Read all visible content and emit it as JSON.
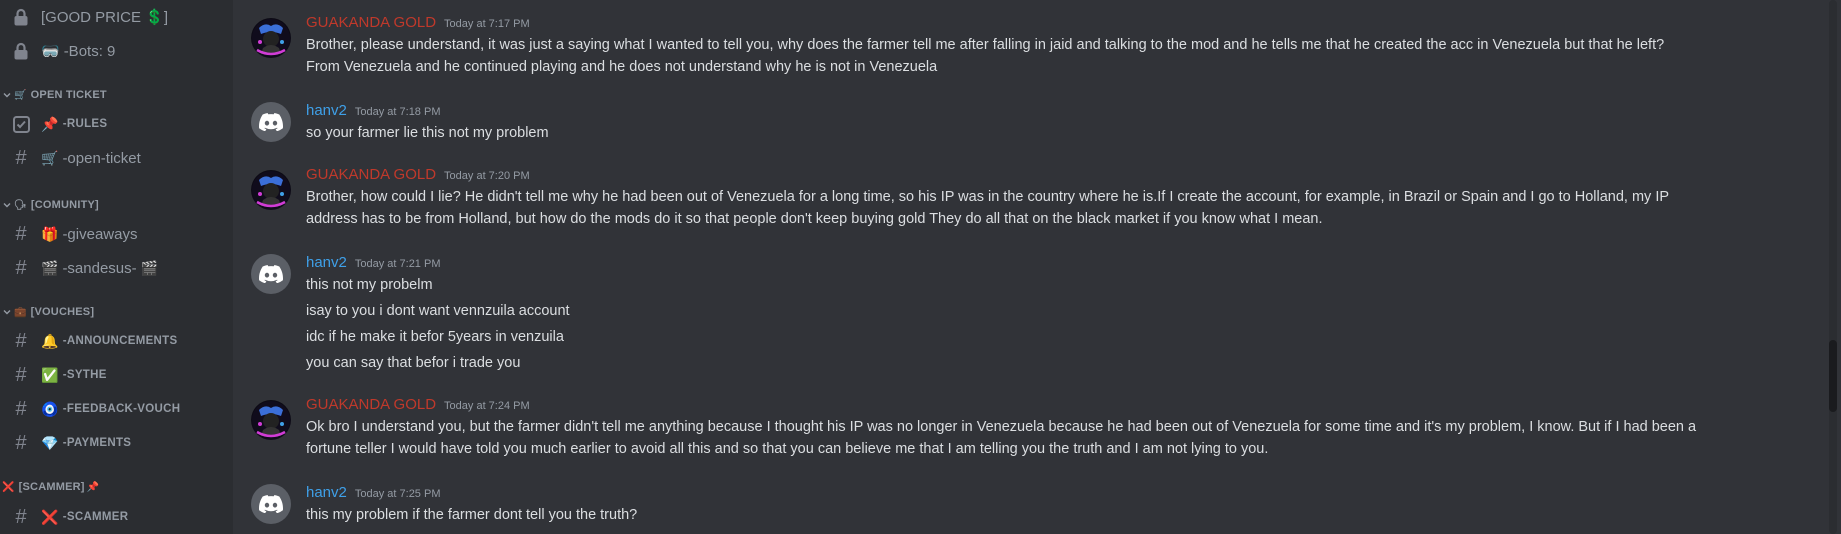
{
  "sidebar": {
    "channels": [
      {
        "name": "[GOOD PRICE 💲]",
        "icon": "lock-icon"
      },
      {
        "name": "-Bots: 9",
        "emoji": "🥽",
        "icon": "lock-icon"
      }
    ],
    "categories": [
      {
        "name": "OPEN TICKET",
        "emoji": "🛒"
      },
      {
        "name": "[COMUNITY]",
        "emoji": "🗣"
      },
      {
        "name": "[VOUCHES]",
        "emoji": "💼"
      },
      {
        "name": "[SCAMMER]",
        "emoji": "❌",
        "suffix": "📌"
      }
    ],
    "open_ticket": [
      {
        "name": "-RULES",
        "emoji": "📌",
        "icon": "rules-checkbox-icon"
      },
      {
        "name": "-open-ticket",
        "emoji": "🛒",
        "icon": "hash-icon"
      }
    ],
    "community": [
      {
        "name": "-giveaways",
        "emoji": "🎁",
        "icon": "hash-icon"
      },
      {
        "name": "-sandesus-",
        "emoji": "🎬",
        "suffix": "🎬",
        "icon": "hash-icon"
      }
    ],
    "vouches": [
      {
        "name": "-ANNOUNCEMENTS",
        "emoji": "🔔",
        "icon": "hash-icon"
      },
      {
        "name": "-SYTHE",
        "emoji": "✅",
        "icon": "hash-icon"
      },
      {
        "name": "-FEEDBACK-VOUCH",
        "emoji": "🧿",
        "icon": "hash-icon"
      },
      {
        "name": "-PAYMENTS",
        "emoji": "💎",
        "icon": "hash-icon"
      }
    ],
    "scammer": [
      {
        "name": "-SCAMMER",
        "emoji": "❌",
        "icon": "hash-icon"
      }
    ]
  },
  "colors": {
    "chat_bg": "#313338",
    "sidebar_bg": "#2b2d31",
    "gold_name": "#c0392b",
    "hanv_name": "#3fa0e8",
    "text": "#dbdee1",
    "muted": "#949ba4"
  },
  "messages": [
    {
      "author": "GUAKANDA GOLD",
      "time": "Today at 7:17 PM",
      "lines": [
        "Brother, please understand, it was just a saying what I wanted to tell you, why does the farmer tell me after falling in jaid and talking to the mod and he tells me that he created the acc in Venezuela but that he left?",
        "From Venezuela and he continued playing and he does not understand why he is not in Venezuela"
      ]
    },
    {
      "author": "hanv2",
      "time": "Today at 7:18 PM",
      "lines": [
        "so your farmer lie this not my problem"
      ]
    },
    {
      "author": "GUAKANDA GOLD",
      "time": "Today at 7:20 PM",
      "lines": [
        "Brother, how could I lie? He didn't tell me why he had been out of Venezuela for a long time, so his IP was in the country where he is.If I create the account, for example, in Brazil or Spain and I go to Holland, my IP",
        "address has to be from Holland, but how do the mods do it so that people don't keep buying gold They do all that on the black market if you know what I mean."
      ]
    },
    {
      "author": "hanv2",
      "time": "Today at 7:21 PM",
      "lines": [
        "this not my probelm",
        "isay to you i dont want vennzuila account",
        "idc if he make it befor 5years in venzuila",
        "you can say that befor i trade you"
      ]
    },
    {
      "author": "GUAKANDA GOLD",
      "time": "Today at 7:24 PM",
      "lines": [
        "Ok bro I understand you, but the farmer didn't tell me anything because I thought his IP was no longer in Venezuela because he had been out of Venezuela for some time and it's my problem, I know. But if I had been a",
        "fortune teller I would have told you much earlier to avoid all this and so that you can believe me that I am telling you the truth and I am not lying to you."
      ]
    },
    {
      "author": "hanv2",
      "time": "Today at 7:25 PM",
      "lines": [
        "this my problem if the farmer dont tell you the truth?"
      ]
    }
  ]
}
